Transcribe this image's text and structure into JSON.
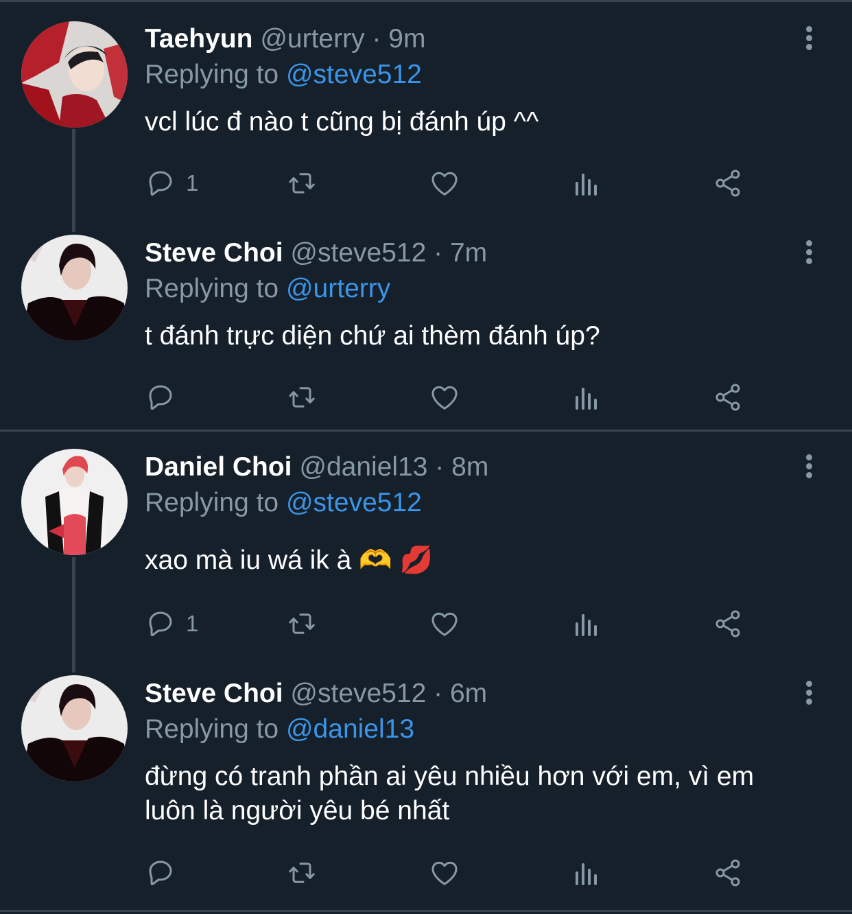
{
  "tweets": [
    {
      "name": "Taehyun",
      "handle": "@urterry",
      "time": "9m",
      "replying_label": "Replying to",
      "replying_to": "@steve512",
      "text": "vcl lúc đ nào t cũng bị đánh úp ^^",
      "reply_count": "1",
      "avatar": "avatar-taehyun"
    },
    {
      "name": "Steve Choi",
      "handle": "@steve512",
      "time": "7m",
      "replying_label": "Replying to",
      "replying_to": "@urterry",
      "text": "t đánh trực diện chứ ai thèm đánh úp?",
      "reply_count": "",
      "avatar": "avatar-steve"
    },
    {
      "name": "Daniel Choi",
      "handle": "@daniel13",
      "time": "8m",
      "replying_label": "Replying to",
      "replying_to": "@steve512",
      "text": "xao mà iu wá ik à 🫶 💋",
      "reply_count": "1",
      "avatar": "avatar-daniel"
    },
    {
      "name": "Steve Choi",
      "handle": "@steve512",
      "time": "6m",
      "replying_label": "Replying to",
      "replying_to": "@daniel13",
      "text": "đừng có tranh phần ai yêu nhiều hơn với em, vì em luôn là người yêu bé nhất",
      "reply_count": "",
      "avatar": "avatar-steve"
    }
  ],
  "separator": "·",
  "icons": [
    "reply-icon",
    "retweet-icon",
    "like-icon",
    "views-icon",
    "share-icon",
    "more-icon"
  ],
  "colors": {
    "background": "#15202b",
    "muted": "#8899a6",
    "link": "#3a95e8",
    "text": "#ffffff",
    "line": "#38444d"
  }
}
